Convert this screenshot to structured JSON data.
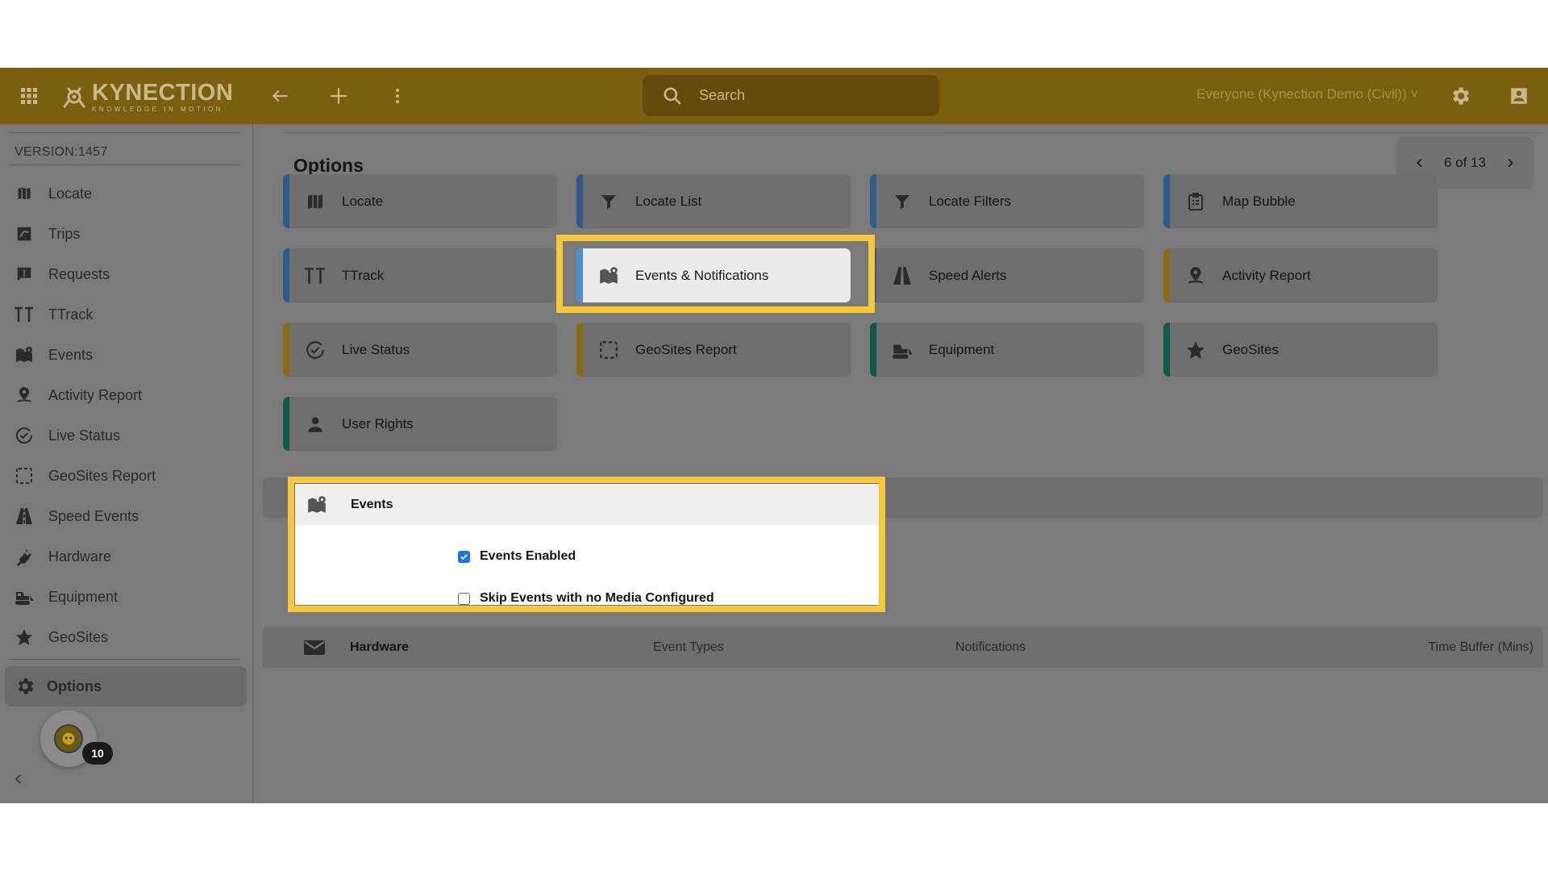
{
  "app": {
    "brand": "KYNECTION",
    "tagline": "KNOWLEDGE IN MOTION"
  },
  "topbar": {
    "search_placeholder": "Search",
    "org_selector": "Everyone (Kynection Demo (Civil)) ˅"
  },
  "sidebar": {
    "version": "VERSION:1457",
    "items": [
      {
        "label": "Locate",
        "icon": "map-icon"
      },
      {
        "label": "Trips",
        "icon": "trips-map-icon"
      },
      {
        "label": "Requests",
        "icon": "chat-alert-icon"
      },
      {
        "label": "TTrack",
        "icon": "ttrack-icon"
      },
      {
        "label": "Events",
        "icon": "map-pin-icon"
      },
      {
        "label": "Activity Report",
        "icon": "person-pin-icon"
      },
      {
        "label": "Live Status",
        "icon": "circle-check-icon"
      },
      {
        "label": "GeoSites Report",
        "icon": "dashed-square-icon"
      },
      {
        "label": "Speed Events",
        "icon": "road-icon"
      },
      {
        "label": "Hardware",
        "icon": "plug-icon"
      },
      {
        "label": "Equipment",
        "icon": "bulldozer-icon"
      },
      {
        "label": "GeoSites",
        "icon": "star-icon"
      }
    ],
    "active": {
      "label": "Options",
      "icon": "gear-icon"
    },
    "notification_count": "10"
  },
  "main": {
    "title": "Options",
    "pager": {
      "text": "6 of 13"
    },
    "tiles": [
      {
        "label": "Locate",
        "icon": "map-icon",
        "accent": "#2f5b8c"
      },
      {
        "label": "Locate List",
        "icon": "filter-icon",
        "accent": "#2f5b8c"
      },
      {
        "label": "Locate Filters",
        "icon": "filter-icon",
        "accent": "#2f5b8c"
      },
      {
        "label": "Map Bubble",
        "icon": "clipboard-icon",
        "accent": "#2f5b8c"
      },
      {
        "label": "TTrack",
        "icon": "ttrack-icon",
        "accent": "#2f5b8c"
      },
      {
        "label": "Events & Notifications",
        "icon": "map-pin-icon",
        "accent": "#4a90d9"
      },
      {
        "label": "Speed Alerts",
        "icon": "road-icon",
        "accent": "#2f5b8c"
      },
      {
        "label": "Activity Report",
        "icon": "person-pin-icon",
        "accent": "#8a6a10"
      },
      {
        "label": "Live Status",
        "icon": "circle-check-icon",
        "accent": "#8a6a10"
      },
      {
        "label": "GeoSites Report",
        "icon": "dashed-square-icon",
        "accent": "#8a6a10"
      },
      {
        "label": "Equipment",
        "icon": "bulldozer-icon",
        "accent": "#0d5a4a"
      },
      {
        "label": "GeoSites",
        "icon": "star-icon",
        "accent": "#0d5a4a"
      },
      {
        "label": "User Rights",
        "icon": "person-icon",
        "accent": "#0d5a4a"
      }
    ],
    "events": {
      "header": "Events",
      "options": [
        {
          "label": "Events Enabled",
          "checked": true
        },
        {
          "label": "Skip Events with no Media Configured",
          "checked": false
        }
      ]
    },
    "hardware_table": {
      "header": "Hardware",
      "columns": [
        "Event Types",
        "Notifications",
        "Time Buffer (Mins)"
      ]
    }
  },
  "colors": {
    "topbar": "#7b5f0e",
    "highlight": "#f6c83a",
    "checkbox": "#1a73e8"
  }
}
